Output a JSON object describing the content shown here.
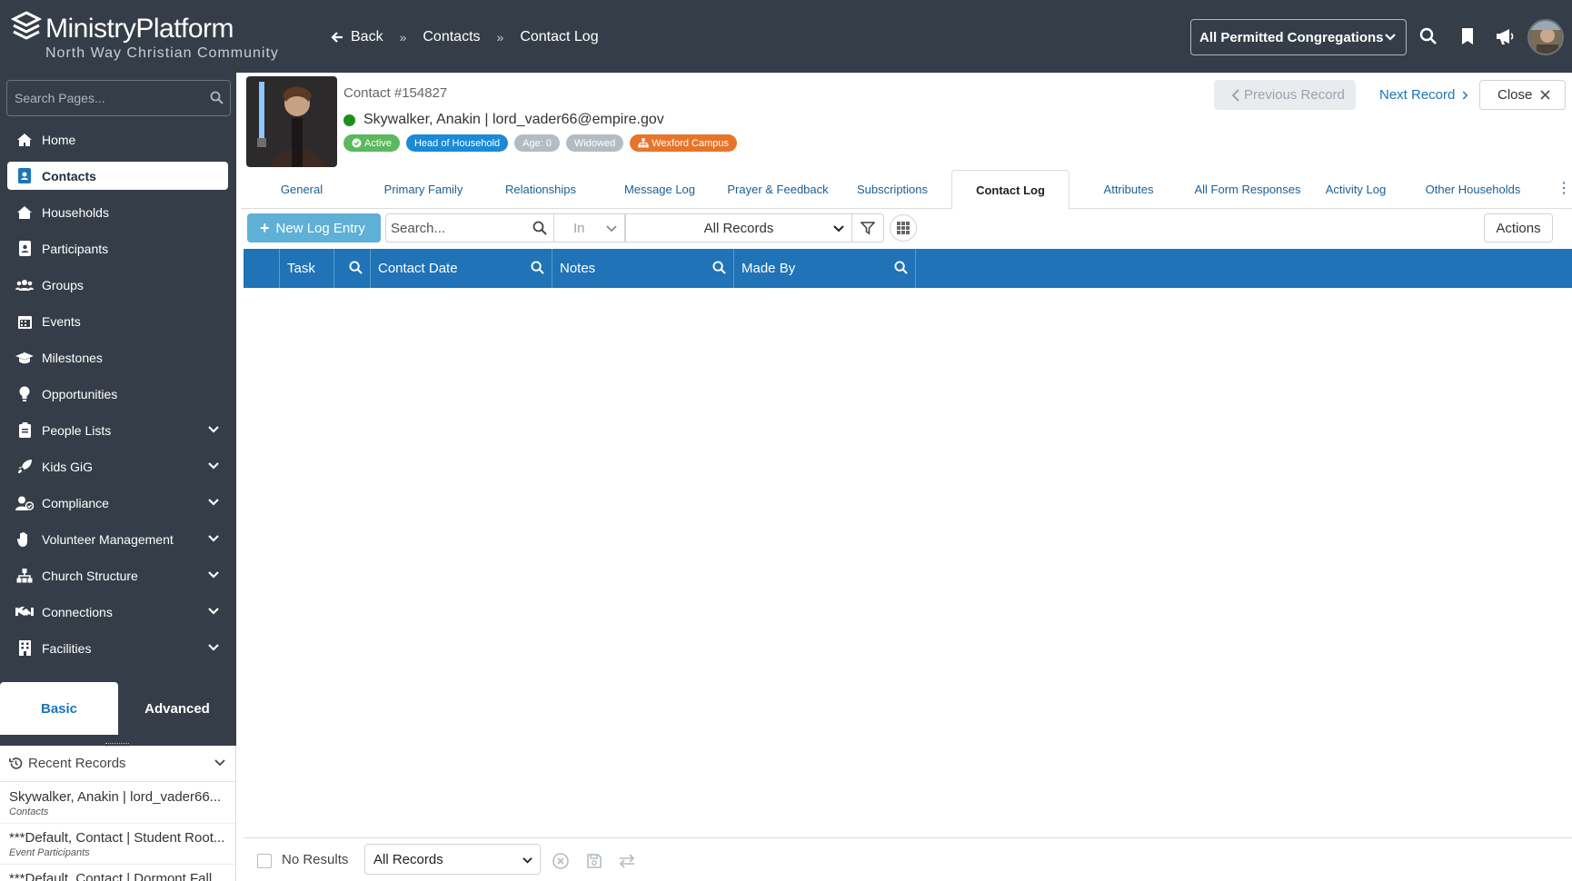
{
  "app": {
    "name": "MinistryPlatform",
    "subtitle": "North Way Christian Community"
  },
  "breadcrumb": {
    "back_label": "Back",
    "items": [
      "Contacts",
      "Contact Log"
    ]
  },
  "topbar": {
    "congregation_select": "All Permitted Congregations",
    "icons": [
      "search-icon",
      "bookmark-icon",
      "megaphone-icon",
      "user-avatar"
    ]
  },
  "sidebar": {
    "search_placeholder": "Search Pages...",
    "items": [
      {
        "label": "Home",
        "icon": "home-icon",
        "expandable": false
      },
      {
        "label": "Contacts",
        "icon": "contact-card-icon",
        "expandable": false,
        "active": true
      },
      {
        "label": "Households",
        "icon": "house-icon",
        "expandable": false
      },
      {
        "label": "Participants",
        "icon": "badge-icon",
        "expandable": false
      },
      {
        "label": "Groups",
        "icon": "users-icon",
        "expandable": false
      },
      {
        "label": "Events",
        "icon": "calendar-icon",
        "expandable": false
      },
      {
        "label": "Milestones",
        "icon": "graduation-cap-icon",
        "expandable": false
      },
      {
        "label": "Opportunities",
        "icon": "lightbulb-icon",
        "expandable": false
      },
      {
        "label": "People Lists",
        "icon": "clipboard-icon",
        "expandable": true
      },
      {
        "label": "Kids GiG",
        "icon": "rocket-icon",
        "expandable": true
      },
      {
        "label": "Compliance",
        "icon": "user-check-icon",
        "expandable": true
      },
      {
        "label": "Volunteer Management",
        "icon": "hand-icon",
        "expandable": true
      },
      {
        "label": "Church Structure",
        "icon": "sitemap-icon",
        "expandable": true
      },
      {
        "label": "Connections",
        "icon": "handshake-icon",
        "expandable": true
      },
      {
        "label": "Facilities",
        "icon": "building-icon",
        "expandable": true
      }
    ],
    "mode_tabs": {
      "basic": "Basic",
      "advanced": "Advanced"
    },
    "recent": {
      "title": "Recent Records",
      "items": [
        {
          "title": "Skywalker, Anakin | lord_vader66...",
          "subtitle": "Contacts"
        },
        {
          "title": "***Default, Contact | Student Root...",
          "subtitle": "Event Participants"
        },
        {
          "title": "***Default, Contact | Dormont Fall...",
          "subtitle": ""
        }
      ]
    }
  },
  "record": {
    "contact_number": "Contact #154827",
    "name_email": "Skywalker, Anakin | lord_vader66@empire.gov",
    "badges": [
      {
        "label": "Active",
        "color": "#5cb85c",
        "icon": "check-circle-icon"
      },
      {
        "label": "Head of Household",
        "color": "#1b8ad6",
        "icon": ""
      },
      {
        "label": "Age: 0",
        "color": "#b4bcc3",
        "icon": ""
      },
      {
        "label": "Widowed",
        "color": "#b4bcc3",
        "icon": ""
      },
      {
        "label": "Wexford Campus",
        "color": "#e8742c",
        "icon": "sitemap-icon"
      }
    ],
    "prev_label": "Previous Record",
    "next_label": "Next Record",
    "close_label": "Close"
  },
  "tabs": [
    {
      "label": "General"
    },
    {
      "label": "Primary Family"
    },
    {
      "label": "Relationships"
    },
    {
      "label": "Message Log"
    },
    {
      "label": "Prayer & Feedback"
    },
    {
      "label": "Subscriptions"
    },
    {
      "label": "Contact Log",
      "active": true
    },
    {
      "label": "Attributes"
    },
    {
      "label": "All Form Responses"
    },
    {
      "label": "Activity Log"
    },
    {
      "label": "Other Households"
    }
  ],
  "toolbar": {
    "new_label": "New Log Entry",
    "search_placeholder": "Search...",
    "in_label": "In",
    "records_select": "All Records",
    "actions_label": "Actions"
  },
  "grid": {
    "columns": [
      "Task",
      "Contact Date",
      "Notes",
      "Made By"
    ],
    "rows": []
  },
  "footer": {
    "results_label": "No Results",
    "view_select": "All Records"
  },
  "colors": {
    "topbar": "#353e48",
    "accent": "#1f73b6",
    "link": "#1b75bb",
    "active_status": "#1c8e1c"
  }
}
